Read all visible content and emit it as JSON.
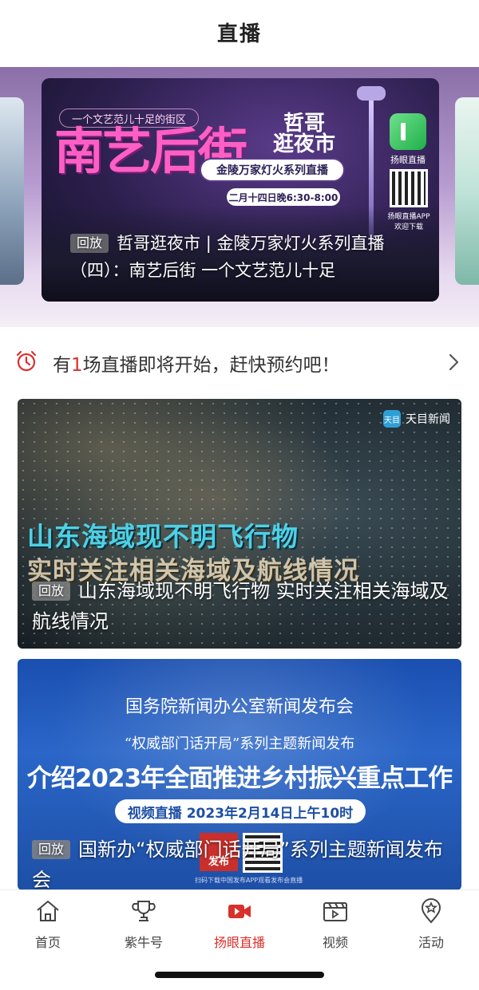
{
  "header": {
    "title": "直播"
  },
  "carousel": {
    "hero": {
      "tagline": "一个文艺范儿十足的街区",
      "big_title": "南艺后街",
      "logo_line1": "哲哥",
      "logo_line2": "逛夜市",
      "pill": "金陵万家灯火系列直播",
      "time": "二月十四日晚6:30-8:00",
      "app_name": "扬眼直播",
      "qr_caption": "扬眼直播APP 欢迎下载",
      "badge": "回放",
      "caption": "哲哥逛夜市 | 金陵万家灯火系列直播（四）：南艺后街 一个文艺范儿十足"
    }
  },
  "reminder": {
    "prefix": "有",
    "count": "1",
    "suffix": "场直播即将开始，赶快预约吧！"
  },
  "cards": [
    {
      "brand": "天目新闻",
      "overlay_line1": "山东海域现不明飞行物",
      "overlay_line2": "实时关注相关海域及航线情况",
      "badge": "回放",
      "caption": "山东海域现不明飞行物 实时关注相关海域及航线情况"
    },
    {
      "line1": "国务院新闻办公室新闻发布会",
      "line2": "“权威部门话开局”系列主题新闻发布",
      "line3": "介绍2023年全面推进乡村振兴重点工作",
      "pill": "视频直播 2023年2月14日上午10时",
      "stamp": "发布",
      "small": "扫码下载中国发布APP观看发布会直播",
      "badge": "回放",
      "caption": "国新办“权威部门话开局”系列主题新闻发布会"
    }
  ],
  "tabbar": {
    "tabs": [
      {
        "label": "首页",
        "icon": "home-icon",
        "active": false
      },
      {
        "label": "紫牛号",
        "icon": "trophy-icon",
        "active": false
      },
      {
        "label": "扬眼直播",
        "icon": "video-camera-icon",
        "active": true
      },
      {
        "label": "视频",
        "icon": "clapperboard-icon",
        "active": false
      },
      {
        "label": "活动",
        "icon": "location-star-icon",
        "active": false
      }
    ]
  },
  "colors": {
    "accent": "#d9302c",
    "text": "#333333"
  }
}
